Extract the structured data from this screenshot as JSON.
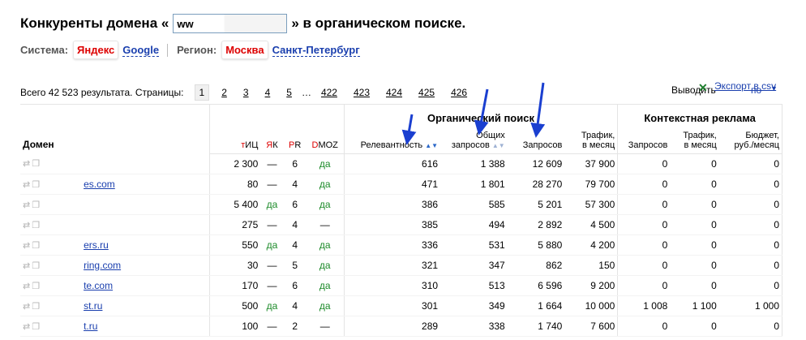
{
  "title": {
    "prefix": "Конкуренты домена «",
    "domain_value": "ww",
    "suffix": "» в органическом поиске."
  },
  "filters": {
    "system_label": "Система:",
    "system_selected": "Яндекс",
    "system_other": "Google",
    "region_label": "Регион:",
    "region_selected": "Москва",
    "region_other": "Санкт-Петербург"
  },
  "pager": {
    "total": "Всего 42 523 результата. Страницы:",
    "pages": [
      "1",
      "2",
      "3",
      "4",
      "5",
      "422",
      "423",
      "424",
      "425",
      "426"
    ],
    "dots": "…",
    "current": "1"
  },
  "export": {
    "show_label": "Выводить",
    "export_label": "Экспорт в csv",
    "count": "по",
    "caret": "▼"
  },
  "table": {
    "group_organic": "Органический поиск",
    "group_context": "Контекстная реклама",
    "columns": {
      "domain": "Домен",
      "tic": "тИЦ",
      "yak": "ЯК",
      "pr": "PR",
      "dmoz": "DMOZ",
      "relevance": "Релевантность",
      "total_queries_1": "Общих",
      "total_queries_2": "запросов",
      "queries": "Запросов",
      "traffic_1": "Трафик,",
      "traffic_2": "в месяц",
      "ctx_queries": "Запросов",
      "ctx_traffic_1": "Трафик,",
      "ctx_traffic_2": "в месяц",
      "budget_1": "Бюджет,",
      "budget_2": "руб./месяц"
    },
    "rows": [
      {
        "domain": "",
        "tic": "2 300",
        "yak": "—",
        "pr": "6",
        "dmoz": "да",
        "rel": "616",
        "total": "1 388",
        "queries": "12 609",
        "traffic": "37 900",
        "cq": "0",
        "ct": "0",
        "cb": "0"
      },
      {
        "domain": "es.com",
        "tic": "80",
        "yak": "—",
        "pr": "4",
        "dmoz": "да",
        "rel": "471",
        "total": "1 801",
        "queries": "28 270",
        "traffic": "79 700",
        "cq": "0",
        "ct": "0",
        "cb": "0"
      },
      {
        "domain": "",
        "tic": "5 400",
        "yak": "да",
        "pr": "6",
        "dmoz": "да",
        "rel": "386",
        "total": "585",
        "queries": "5 201",
        "traffic": "57 300",
        "cq": "0",
        "ct": "0",
        "cb": "0"
      },
      {
        "domain": "",
        "tic": "275",
        "yak": "—",
        "pr": "4",
        "dmoz": "—",
        "rel": "385",
        "total": "494",
        "queries": "2 892",
        "traffic": "4 500",
        "cq": "0",
        "ct": "0",
        "cb": "0"
      },
      {
        "domain": "ers.ru",
        "tic": "550",
        "yak": "да",
        "pr": "4",
        "dmoz": "да",
        "rel": "336",
        "total": "531",
        "queries": "5 880",
        "traffic": "4 200",
        "cq": "0",
        "ct": "0",
        "cb": "0"
      },
      {
        "domain": "ring.com",
        "tic": "30",
        "yak": "—",
        "pr": "5",
        "dmoz": "да",
        "rel": "321",
        "total": "347",
        "queries": "862",
        "traffic": "150",
        "cq": "0",
        "ct": "0",
        "cb": "0"
      },
      {
        "domain": "te.com",
        "tic": "170",
        "yak": "—",
        "pr": "6",
        "dmoz": "да",
        "rel": "310",
        "total": "513",
        "queries": "6 596",
        "traffic": "9 200",
        "cq": "0",
        "ct": "0",
        "cb": "0"
      },
      {
        "domain": "st.ru",
        "tic": "500",
        "yak": "да",
        "pr": "4",
        "dmoz": "да",
        "rel": "301",
        "total": "349",
        "queries": "1 664",
        "traffic": "10 000",
        "cq": "1 008",
        "ct": "1 100",
        "cb": "1 000"
      },
      {
        "domain": "t.ru",
        "tic": "100",
        "yak": "—",
        "pr": "2",
        "dmoz": "—",
        "rel": "289",
        "total": "338",
        "queries": "1 740",
        "traffic": "7 600",
        "cq": "0",
        "ct": "0",
        "cb": "0"
      }
    ]
  },
  "colors": {
    "accent_red": "#dd0000",
    "link_blue": "#1a3fae",
    "yes_green": "#1b8a28",
    "annotation_arrow": "#1a3fd0"
  },
  "icons": [
    "swap-arrows-icon",
    "window-icon",
    "sort-desc-icon",
    "sort-both-icon",
    "excel-icon",
    "dropdown-caret-icon",
    "annotation-arrow-icon"
  ]
}
